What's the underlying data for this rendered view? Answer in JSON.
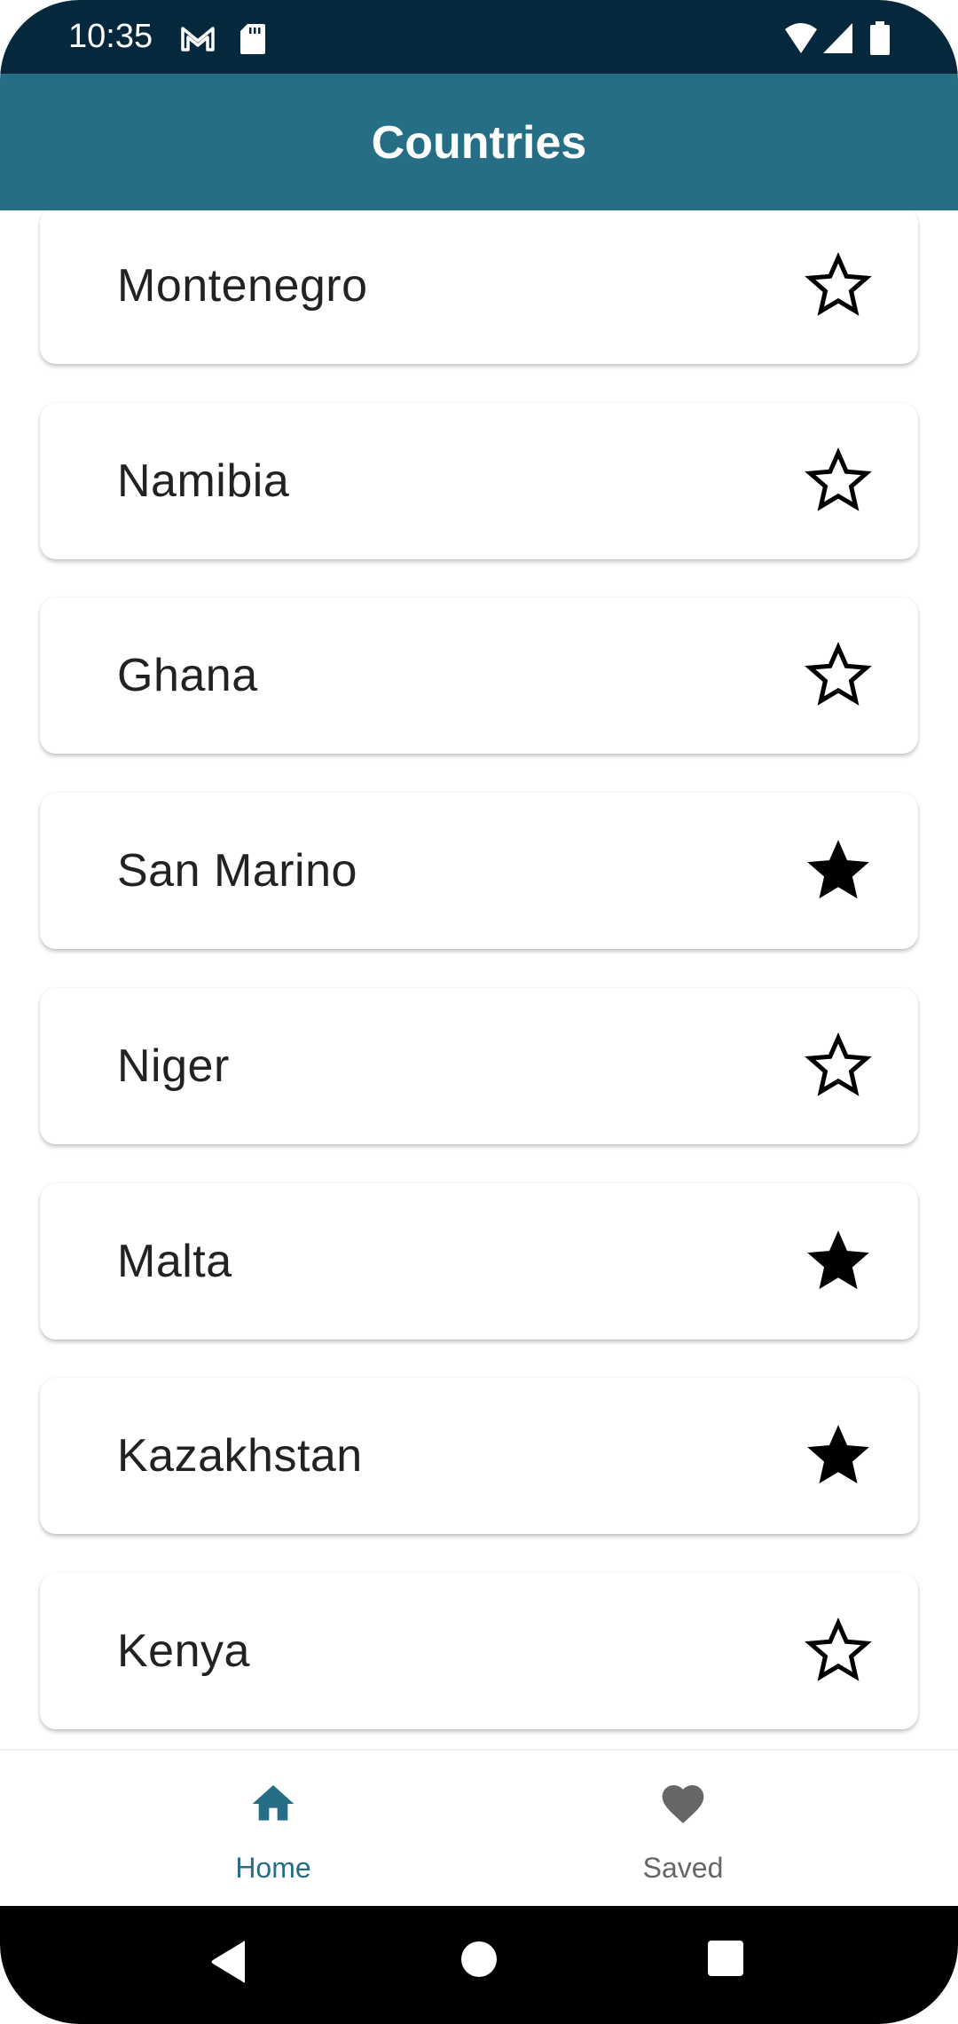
{
  "status_bar": {
    "time": "10:35",
    "left_icons": [
      "gmail-icon",
      "sd-card-icon"
    ],
    "right_icons": [
      "wifi-icon",
      "signal-icon",
      "battery-icon"
    ]
  },
  "app_bar": {
    "title": "Countries"
  },
  "colors": {
    "primary": "#266e85",
    "status_bar": "#06283d",
    "inactive": "#666666"
  },
  "countries": [
    {
      "name": "Montenegro",
      "saved": false
    },
    {
      "name": "Namibia",
      "saved": false
    },
    {
      "name": "Ghana",
      "saved": false
    },
    {
      "name": "San Marino",
      "saved": true
    },
    {
      "name": "Niger",
      "saved": false
    },
    {
      "name": "Malta",
      "saved": true
    },
    {
      "name": "Kazakhstan",
      "saved": true
    },
    {
      "name": "Kenya",
      "saved": false
    }
  ],
  "bottom_nav": {
    "items": [
      {
        "label": "Home",
        "icon": "home-icon",
        "active": true
      },
      {
        "label": "Saved",
        "icon": "heart-icon",
        "active": false
      }
    ]
  }
}
